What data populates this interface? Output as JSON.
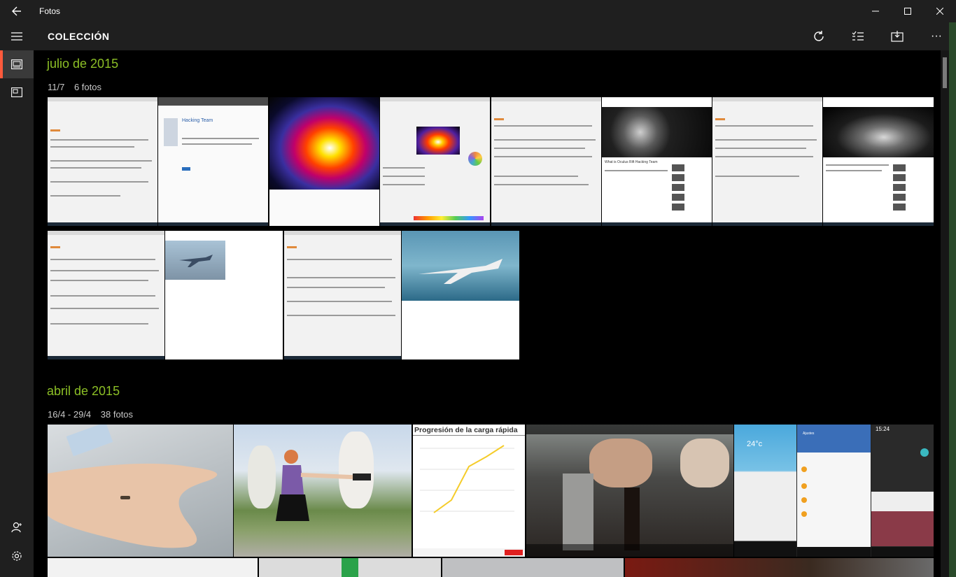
{
  "window": {
    "title": "Fotos",
    "back_icon": "back-arrow-icon",
    "minimize_glyph": "—",
    "maximize_glyph": "☐",
    "close_glyph": "✕"
  },
  "nav": {
    "items": [
      {
        "name": "collection",
        "icon": "photos-collection-icon",
        "active": true
      },
      {
        "name": "albums",
        "icon": "album-icon",
        "active": false
      }
    ],
    "bottom": [
      {
        "name": "account",
        "icon": "person-icon"
      },
      {
        "name": "settings",
        "icon": "gear-icon"
      }
    ]
  },
  "header": {
    "title": "COLECCIÓN",
    "actions": [
      {
        "name": "refresh",
        "icon": "refresh-icon"
      },
      {
        "name": "select",
        "icon": "select-list-icon"
      },
      {
        "name": "import",
        "icon": "import-icon"
      },
      {
        "name": "more",
        "icon": "more-icon",
        "glyph": "···"
      }
    ]
  },
  "groups": [
    {
      "title": "julio de 2015",
      "date_range": "11/7",
      "count": "6 fotos"
    },
    {
      "title": "abril de 2015",
      "date_range": "16/4 - 29/4",
      "count": "38 fotos"
    }
  ],
  "thumbnails": {
    "chart_title": "Progresión de la carga rápida",
    "clock_text": "15:24",
    "weather_text": "24°c",
    "article_heading_1": "Hacking Team",
    "video_title": "What is Oculus Rift Hacking Team",
    "settings_title": "Ajustes"
  },
  "colors": {
    "accent_green": "#8cbf26",
    "active_marker": "#ff5a3c",
    "chrome": "#1f1f1f"
  }
}
